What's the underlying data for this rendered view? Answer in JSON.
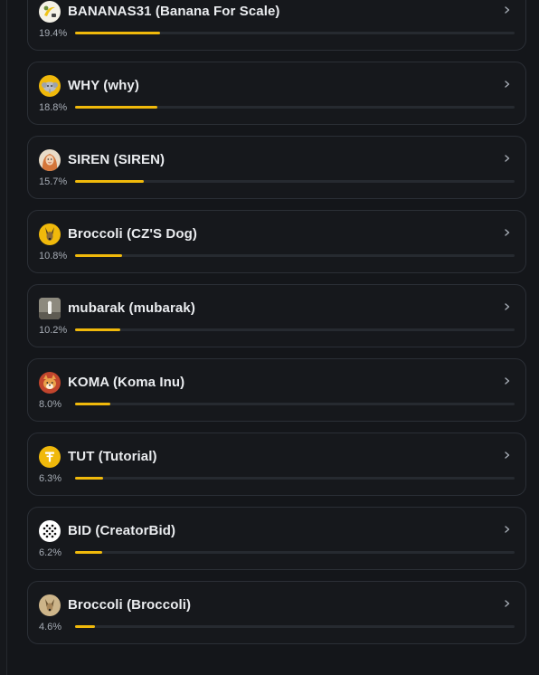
{
  "colors": {
    "background": "#14161a",
    "card": "#16181c",
    "card_border": "#2b2f36",
    "accent": "#f0b90b",
    "text": "#eaecef",
    "muted": "#a6acb5"
  },
  "tokens": [
    {
      "name": "BANANAS31 (Banana For Scale)",
      "percent": "19.4%",
      "share": 19.4,
      "icon": "banana-token-icon"
    },
    {
      "name": "WHY (why)",
      "percent": "18.8%",
      "share": 18.8,
      "icon": "why-elephant-token-icon"
    },
    {
      "name": "SIREN (SIREN)",
      "percent": "15.7%",
      "share": 15.7,
      "icon": "siren-token-icon"
    },
    {
      "name": "Broccoli (CZ'S Dog)",
      "percent": "10.8%",
      "share": 10.8,
      "icon": "broccoli-dog-token-icon"
    },
    {
      "name": "mubarak (mubarak)",
      "percent": "10.2%",
      "share": 10.2,
      "icon": "mubarak-token-icon"
    },
    {
      "name": "KOMA (Koma Inu)",
      "percent": "8.0%",
      "share": 8.0,
      "icon": "koma-inu-token-icon"
    },
    {
      "name": "TUT (Tutorial)",
      "percent": "6.3%",
      "share": 6.3,
      "icon": "tutorial-token-icon"
    },
    {
      "name": "BID (CreatorBid)",
      "percent": "6.2%",
      "share": 6.2,
      "icon": "creatorbid-token-icon"
    },
    {
      "name": "Broccoli (Broccoli)",
      "percent": "4.6%",
      "share": 4.6,
      "icon": "broccoli-token-icon"
    }
  ]
}
